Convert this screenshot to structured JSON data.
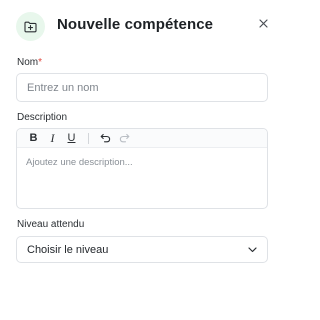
{
  "dialog": {
    "title": "Nouvelle compétence",
    "header_icon": "folder-plus-icon",
    "close_icon": "close-icon"
  },
  "form": {
    "name": {
      "label": "Nom",
      "required_marker": "*",
      "placeholder": "Entrez un nom",
      "value": ""
    },
    "description": {
      "label": "Description",
      "placeholder": "Ajoutez une description...",
      "toolbar": {
        "bold": "B",
        "italic": "I",
        "underline": "U",
        "undo_icon": "undo-icon",
        "redo_icon": "redo-icon"
      }
    },
    "level": {
      "label": "Niveau attendu",
      "selected": "Choisir le niveau",
      "chevron_icon": "chevron-down-icon"
    }
  },
  "colors": {
    "accent_bg": "#e8f7ec",
    "required": "#e0453b",
    "border": "#dfe2e6"
  }
}
